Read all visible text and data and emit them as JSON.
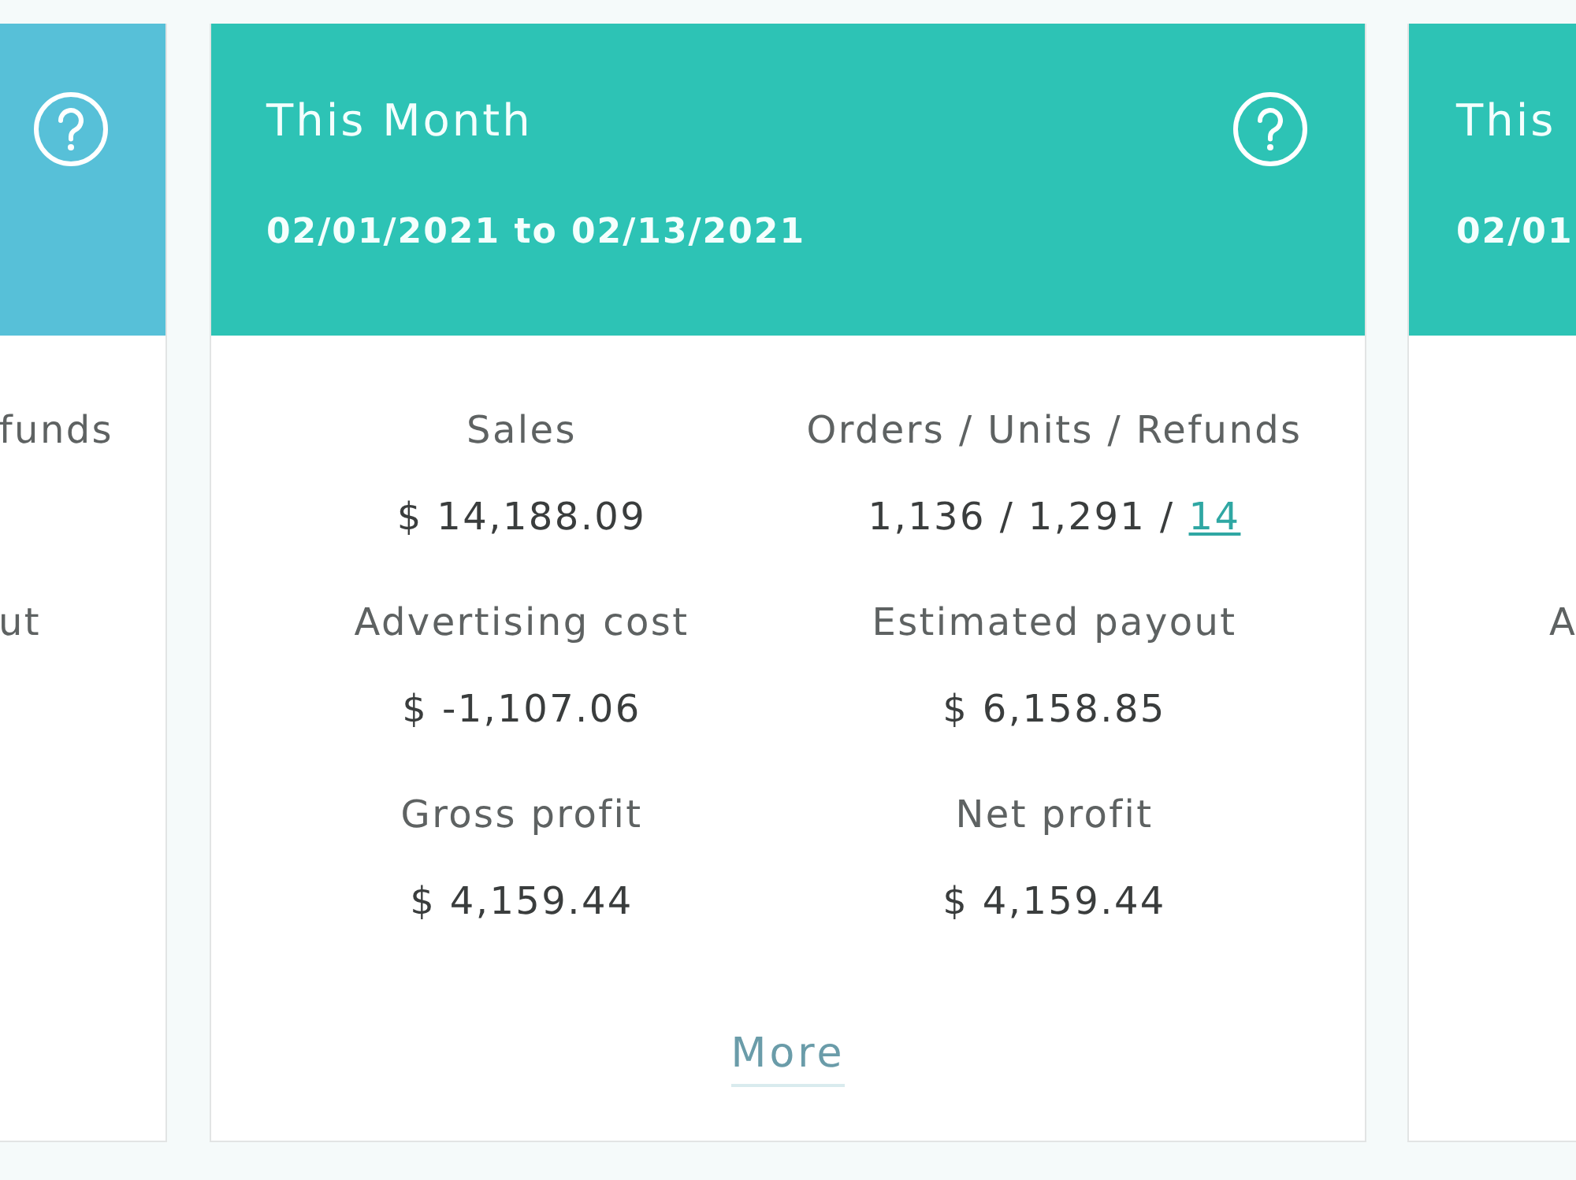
{
  "cards": [
    {
      "kind": "cut-left",
      "color": "#57c0d8",
      "stats": [
        {
          "label": "funds"
        },
        {
          "label": "ut"
        }
      ]
    },
    {
      "kind": "full",
      "color": "#2dc3b5",
      "title": "This Month",
      "date_range": "02/01/2021 to 02/13/2021",
      "stats": [
        {
          "label": "Sales",
          "value": "$ 14,188.09"
        },
        {
          "label": "Orders / Units / Refunds",
          "value": "1,136 / 1,291 /",
          "link": "14"
        },
        {
          "label": "Advertising cost",
          "value": "$ -1,107.06"
        },
        {
          "label": "Estimated payout",
          "value": "$ 6,158.85"
        },
        {
          "label": "Gross profit",
          "value": "$ 4,159.44"
        },
        {
          "label": "Net profit",
          "value": "$ 4,159.44"
        }
      ],
      "more_link": "More"
    },
    {
      "kind": "cut-right",
      "color": "#2dc3b5",
      "title": "This",
      "date_range": "02/01",
      "stats": [
        {
          "label": "A"
        }
      ]
    }
  ]
}
